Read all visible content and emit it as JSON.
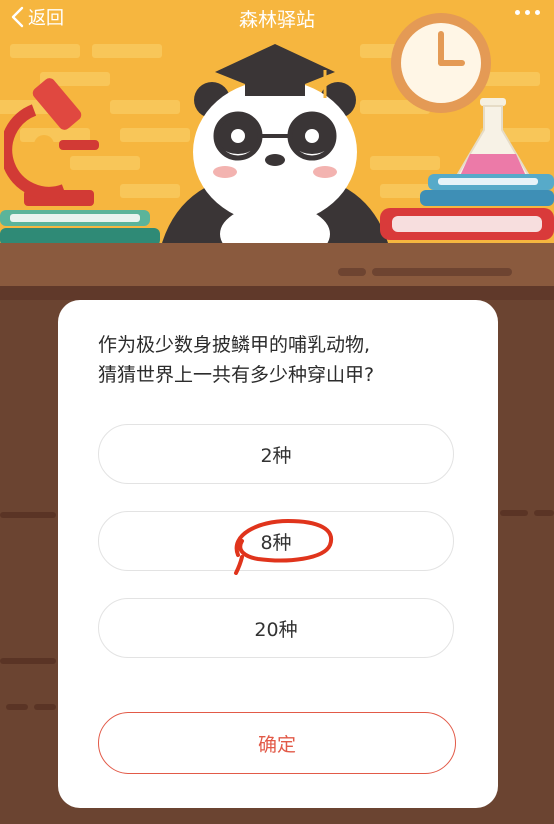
{
  "nav": {
    "back_label": "返回",
    "title": "森林驿站"
  },
  "quiz": {
    "question_line1": "作为极少数身披鳞甲的哺乳动物,",
    "question_line2": "猜猜世界上一共有多少种穿山甲?",
    "options": [
      {
        "label": "2种"
      },
      {
        "label": "8种",
        "marked": true
      },
      {
        "label": "20种"
      }
    ],
    "confirm_label": "确定"
  },
  "colors": {
    "wall": "#f6b63f",
    "desk": "#8a5a3e",
    "board": "#6b4431",
    "accent": "#e25a48",
    "annotation": "#e0341c"
  }
}
